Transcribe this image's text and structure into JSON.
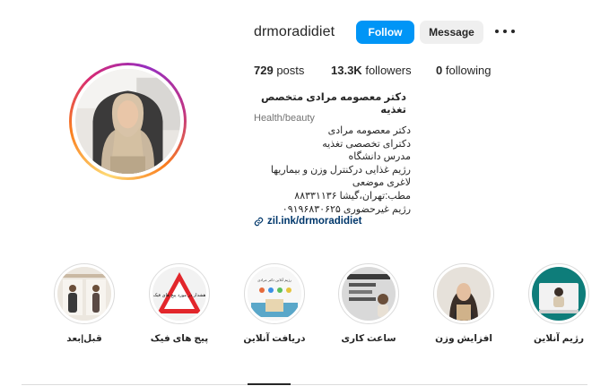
{
  "profile": {
    "username": "drmoradidiet",
    "follow_label": "Follow",
    "message_label": "Message",
    "more_icon": "more-horizontal-icon",
    "stats": {
      "posts_value": "729",
      "posts_label": "posts",
      "followers_value": "13.3K",
      "followers_label": "followers",
      "following_value": "0",
      "following_label": "following"
    },
    "full_name": "دکتر معصومه مرادی متخصص تغذیه",
    "category": "Health/beauty",
    "bio_lines": [
      "دکتر معصومه مرادی",
      "دکترای تخصصی تغذیه",
      "مدرس دانشگاه",
      "رژیم غذایی درکنترل وزن و بیماریها",
      "لاغری موضعی",
      "مطب:تهران،گیشا ۸۸۳۳۱۱۳۶",
      "رژیم غیرحضوری ۰۹۱۹۶۸۳۰۶۲۵"
    ],
    "link_text": "zil.ink/drmoradidiet",
    "link_icon": "link-icon",
    "ring_colors": [
      "#feda75",
      "#fa7e1e",
      "#d62976",
      "#962fbf"
    ]
  },
  "highlights": [
    {
      "label": "قبل|بعد"
    },
    {
      "label": "پیج های فیک"
    },
    {
      "label": "دریافت آنلاین"
    },
    {
      "label": "ساعت کاری"
    },
    {
      "label": "افزایش وزن"
    },
    {
      "label": "رژیم آنلاین"
    }
  ],
  "highlight_thumb_text": {
    "warning_sign": "هشدار در مورد پیج های فیک",
    "online_card": "رژیم آنلاین دکتر مرادی"
  },
  "colors": {
    "primary_button": "#0095f6",
    "secondary_button": "#efefef",
    "link": "#00376b",
    "muted": "#737373"
  }
}
